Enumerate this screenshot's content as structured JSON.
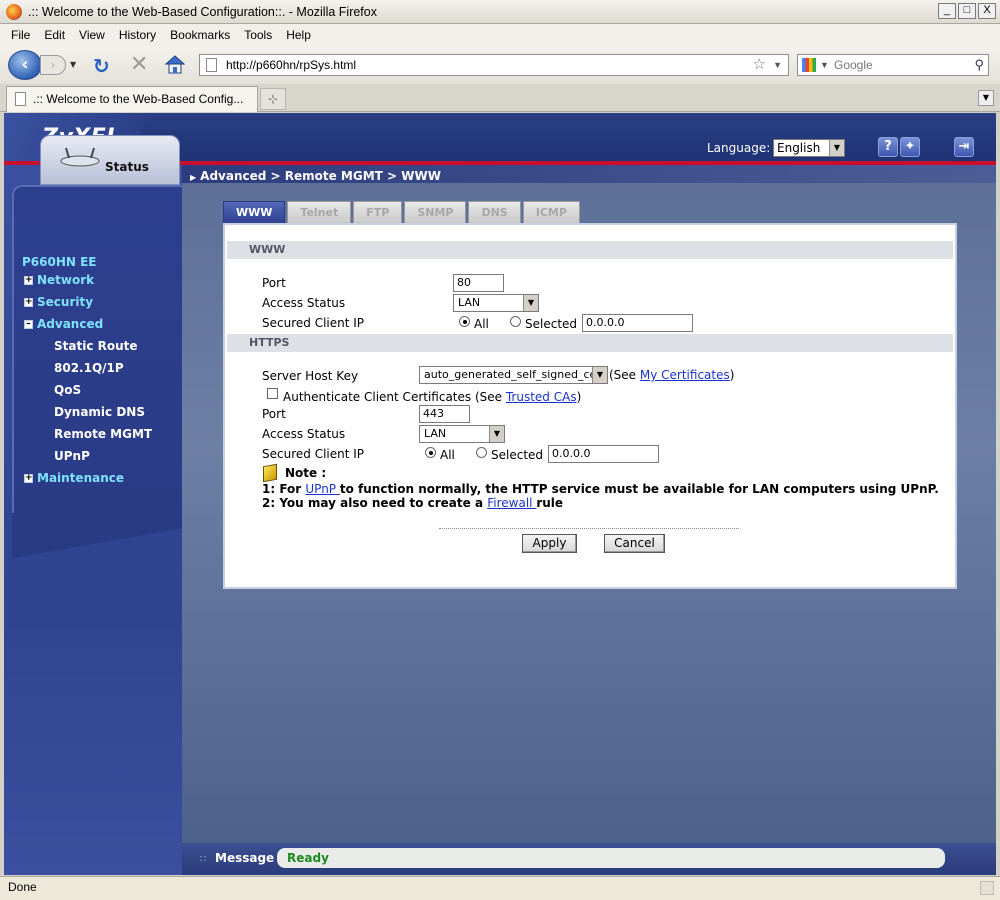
{
  "window": {
    "title": ".:: Welcome to the Web-Based Configuration::. - Mozilla Firefox",
    "min": "_",
    "max": "□",
    "close": "X"
  },
  "menu": [
    "File",
    "Edit",
    "View",
    "History",
    "Bookmarks",
    "Tools",
    "Help"
  ],
  "nav": {
    "url": "http://p660hn/rpSys.html",
    "search_placeholder": "Google"
  },
  "tab": {
    "label": ".:: Welcome to the Web-Based Config..."
  },
  "header": {
    "logo": "ZyXEL",
    "language_label": "Language:",
    "language_value": "English"
  },
  "breadcrumb": "Advanced > Remote MGMT > WWW",
  "sidebar": {
    "status_label": "Status",
    "device": "P660HN EE",
    "items": [
      {
        "label": "Network",
        "expanded": false
      },
      {
        "label": "Security",
        "expanded": false
      },
      {
        "label": "Advanced",
        "expanded": true
      },
      {
        "label": "Maintenance",
        "expanded": false
      }
    ],
    "sub_items": [
      "Static Route",
      "802.1Q/1P",
      "QoS",
      "Dynamic DNS",
      "Remote MGMT",
      "UPnP"
    ]
  },
  "tabs": [
    "WWW",
    "Telnet",
    "FTP",
    "SNMP",
    "DNS",
    "ICMP"
  ],
  "www": {
    "section": "WWW",
    "port_label": "Port",
    "port_value": "80",
    "access_label": "Access Status",
    "access_value": "LAN",
    "client_ip_label": "Secured Client IP",
    "all_label": "All",
    "selected_label": "Selected",
    "ip_value": "0.0.0.0"
  },
  "https": {
    "section": "HTTPS",
    "host_key_label": "Server Host Key",
    "host_key_value": "auto_generated_self_signed_cert",
    "see_open": "(See ",
    "my_certs": "My Certificates",
    "see_close": ")",
    "auth_label": "Authenticate Client Certificates",
    "auth_see": " (See ",
    "trusted_cas": "Trusted CAs",
    "auth_close": ")",
    "port_label": "Port",
    "port_value": "443",
    "access_label": "Access Status",
    "access_value": "LAN",
    "client_ip_label": "Secured Client IP",
    "all_label": "All",
    "selected_label": "Selected",
    "ip_value": "0.0.0.0"
  },
  "note": {
    "title": "Note :",
    "line1_pre": "1: For ",
    "line1_link": "UPnP ",
    "line1_post": "to function normally, the HTTP service must be available for LAN computers using UPnP.",
    "line2_pre": "2: You may also need to create a ",
    "line2_link": "Firewall ",
    "line2_post": "rule"
  },
  "buttons": {
    "apply": "Apply",
    "cancel": "Cancel"
  },
  "message": {
    "label": "Message",
    "value": "Ready"
  },
  "statusbar": "Done"
}
